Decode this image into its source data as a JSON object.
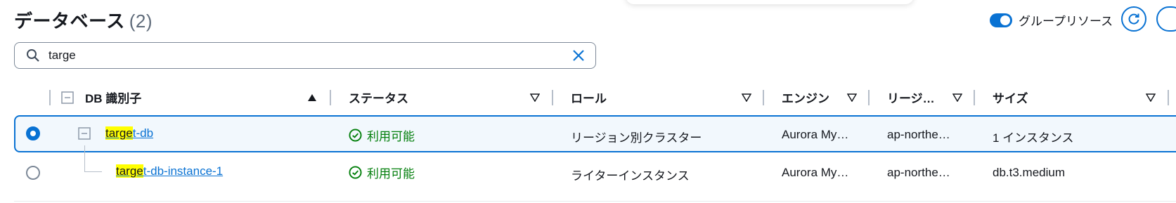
{
  "header": {
    "title": "データベース",
    "count": "(2)",
    "group_toggle_label": "グループリソース"
  },
  "search": {
    "value": "targe",
    "placeholder": ""
  },
  "table": {
    "columns": [
      "DB 識別子",
      "ステータス",
      "ロール",
      "エンジン",
      "リージ…",
      "サイズ"
    ],
    "rows": [
      {
        "id_highlight": "targe",
        "id_rest": "t-db",
        "status": "利用可能",
        "role": "リージョン別クラスター",
        "engine": "Aurora My…",
        "region": "ap-northe…",
        "size": "1 インスタンス",
        "selected": true
      },
      {
        "id_highlight": "targe",
        "id_rest": "t-db-instance-1",
        "status": "利用可能",
        "role": "ライターインスタンス",
        "engine": "Aurora My…",
        "region": "ap-northe…",
        "size": "db.t3.medium",
        "selected": false
      }
    ]
  },
  "colors": {
    "accent": "#0972d3",
    "success": "#037f0c",
    "highlight": "#ffff00"
  }
}
